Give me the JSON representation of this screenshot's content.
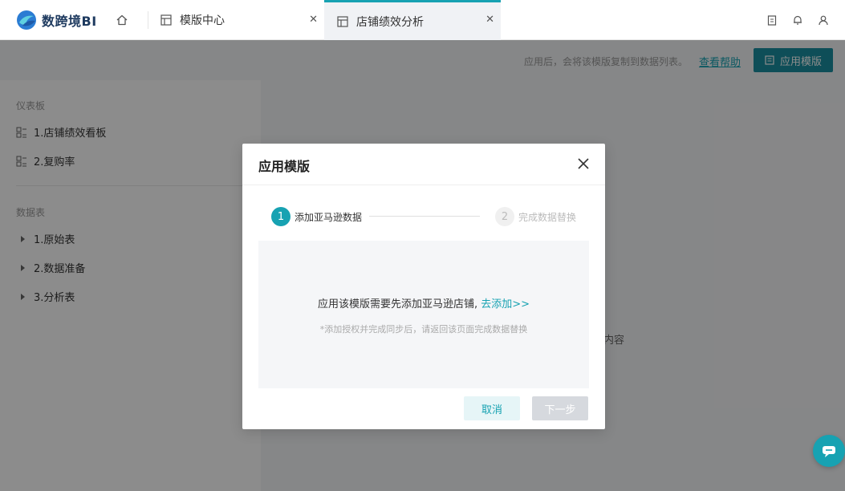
{
  "app": {
    "logo_text": "数跨境BI"
  },
  "tabs": [
    {
      "label": "模版中心",
      "icon": "layout-icon"
    },
    {
      "label": "店铺绩效分析",
      "icon": "layout-icon",
      "active": true
    }
  ],
  "topbar_icons": [
    "clipboard-icon",
    "bell-icon",
    "user-icon"
  ],
  "subbar": {
    "hint": "应用后，会将该模版复制到数据列表。",
    "help": "查看帮助",
    "apply_label": "应用模版"
  },
  "sidebar": {
    "dashboards_title": "仪表板",
    "dashboards": [
      {
        "label": "1.店铺绩效看板",
        "icon": "dashboard-icon"
      },
      {
        "label": "2.复购率",
        "icon": "dashboard-icon"
      }
    ],
    "tables_title": "数据表",
    "tables": [
      {
        "label": "1.原始表",
        "icon": "caret-right-icon"
      },
      {
        "label": "2.数据准备",
        "icon": "caret-right-icon"
      },
      {
        "label": "3.分析表",
        "icon": "caret-right-icon"
      }
    ]
  },
  "main": {
    "partial_text": "内容"
  },
  "modal": {
    "title": "应用模版",
    "steps": [
      {
        "number": "1",
        "label": "添加亚马逊数据",
        "status": "active"
      },
      {
        "number": "2",
        "label": "完成数据替换",
        "status": "pending"
      }
    ],
    "message": "应用该模版需要先添加亚马逊店铺,",
    "message_link": "去添加>>",
    "note": "*添加授权并完成同步后，请返回该页面完成数据替换",
    "cancel_label": "取消",
    "next_label": "下一步"
  },
  "colors": {
    "accent": "#17a2b2",
    "apply_button": "#1a8fa0",
    "overlay": "rgba(0,0,0,0.45)"
  }
}
